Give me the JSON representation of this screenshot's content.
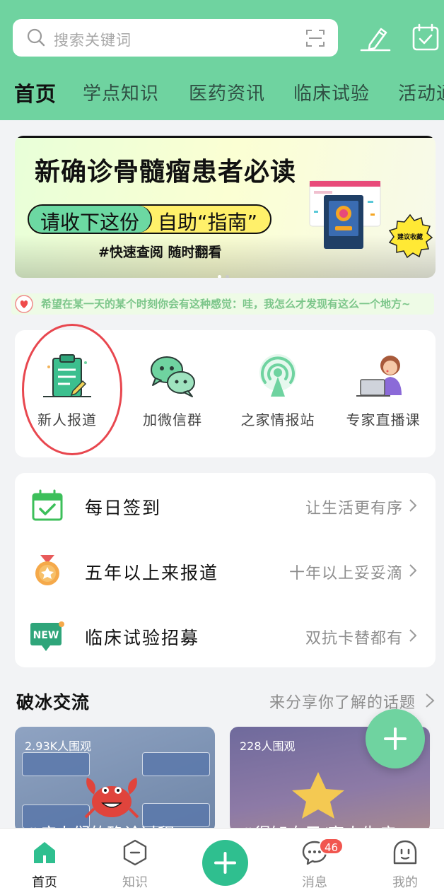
{
  "search": {
    "placeholder": "搜索关键词"
  },
  "header": {
    "icons": [
      "search-icon",
      "scan-icon",
      "edit-pen-icon",
      "calendar-check-icon"
    ],
    "tabs": [
      {
        "label": "首页",
        "active": true
      },
      {
        "label": "学点知识"
      },
      {
        "label": "医药资讯"
      },
      {
        "label": "临床试验"
      },
      {
        "label": "活动通"
      }
    ]
  },
  "banner": {
    "title": "新确诊骨髓瘤患者必读",
    "pill_left": "请收下这份",
    "pill_right": "自助“指南”",
    "subtitle": "#快速查阅 随时翻看",
    "badge": "建议收藏",
    "page_count": 2,
    "active_page": 1
  },
  "marquee": {
    "text": "希望在某一天的某个时刻你会有这种感觉：哇，我怎么才发现有这么一个地方~"
  },
  "quick_links": [
    {
      "label": "新人报道",
      "icon": "clipboard-icon",
      "circled": true
    },
    {
      "label": "加微信群",
      "icon": "wechat-icon"
    },
    {
      "label": "之家情报站",
      "icon": "broadcast-icon"
    },
    {
      "label": "专家直播课",
      "icon": "live-teacher-icon"
    }
  ],
  "list_items": [
    {
      "title": "每日签到",
      "hint": "让生活更有序",
      "icon": "calendar-check-icon"
    },
    {
      "title": "五年以上来报道",
      "hint": "十年以上妥妥滴",
      "icon": "medal-icon"
    },
    {
      "title": "临床试验招募",
      "hint": "双抗卡替都有",
      "icon": "new-badge-icon"
    }
  ],
  "section": {
    "title": "破冰交流",
    "more": "来分享你了解的话题"
  },
  "posts": [
    {
      "views": "2.93K人围观",
      "caption": "#病人们的确诊过程"
    },
    {
      "views": "228人围观",
      "caption": "#得知自己/家人生病"
    }
  ],
  "bottom_nav": [
    {
      "label": "首页",
      "icon": "home-icon",
      "active": true
    },
    {
      "label": "知识",
      "icon": "knowledge-icon"
    },
    {
      "label": "",
      "icon": "plus-icon"
    },
    {
      "label": "消息",
      "icon": "message-icon",
      "badge": "46"
    },
    {
      "label": "我的",
      "icon": "profile-icon"
    }
  ],
  "colors": {
    "brand": "#6fd3a0",
    "accent": "#2fbf8f",
    "badge": "#f1564f",
    "annotation": "#e8474f"
  }
}
